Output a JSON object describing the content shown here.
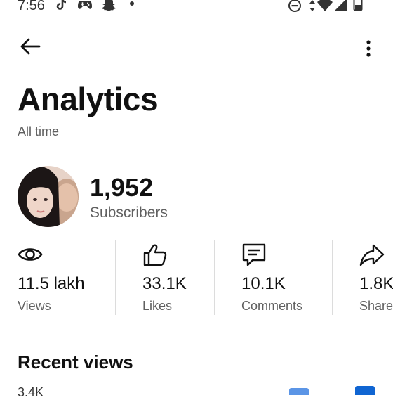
{
  "status_bar": {
    "time": "7:56"
  },
  "header": {
    "title": "Analytics",
    "subtitle": "All time"
  },
  "channel": {
    "subscribers_value": "1,952",
    "subscribers_label": "Subscribers"
  },
  "stats": [
    {
      "icon": "eye-icon",
      "value": "11.5 lakh",
      "label": "Views"
    },
    {
      "icon": "thumbs-up-icon",
      "value": "33.1K",
      "label": "Likes"
    },
    {
      "icon": "comment-icon",
      "value": "10.1K",
      "label": "Comments"
    },
    {
      "icon": "share-icon",
      "value": "1.8K",
      "label": "Shares"
    }
  ],
  "recent_views": {
    "title": "Recent views",
    "partial_value": "3.4K"
  },
  "colors": {
    "bar_light": "#5b95e6",
    "bar_dark": "#1065d2",
    "muted_text": "#606060"
  }
}
